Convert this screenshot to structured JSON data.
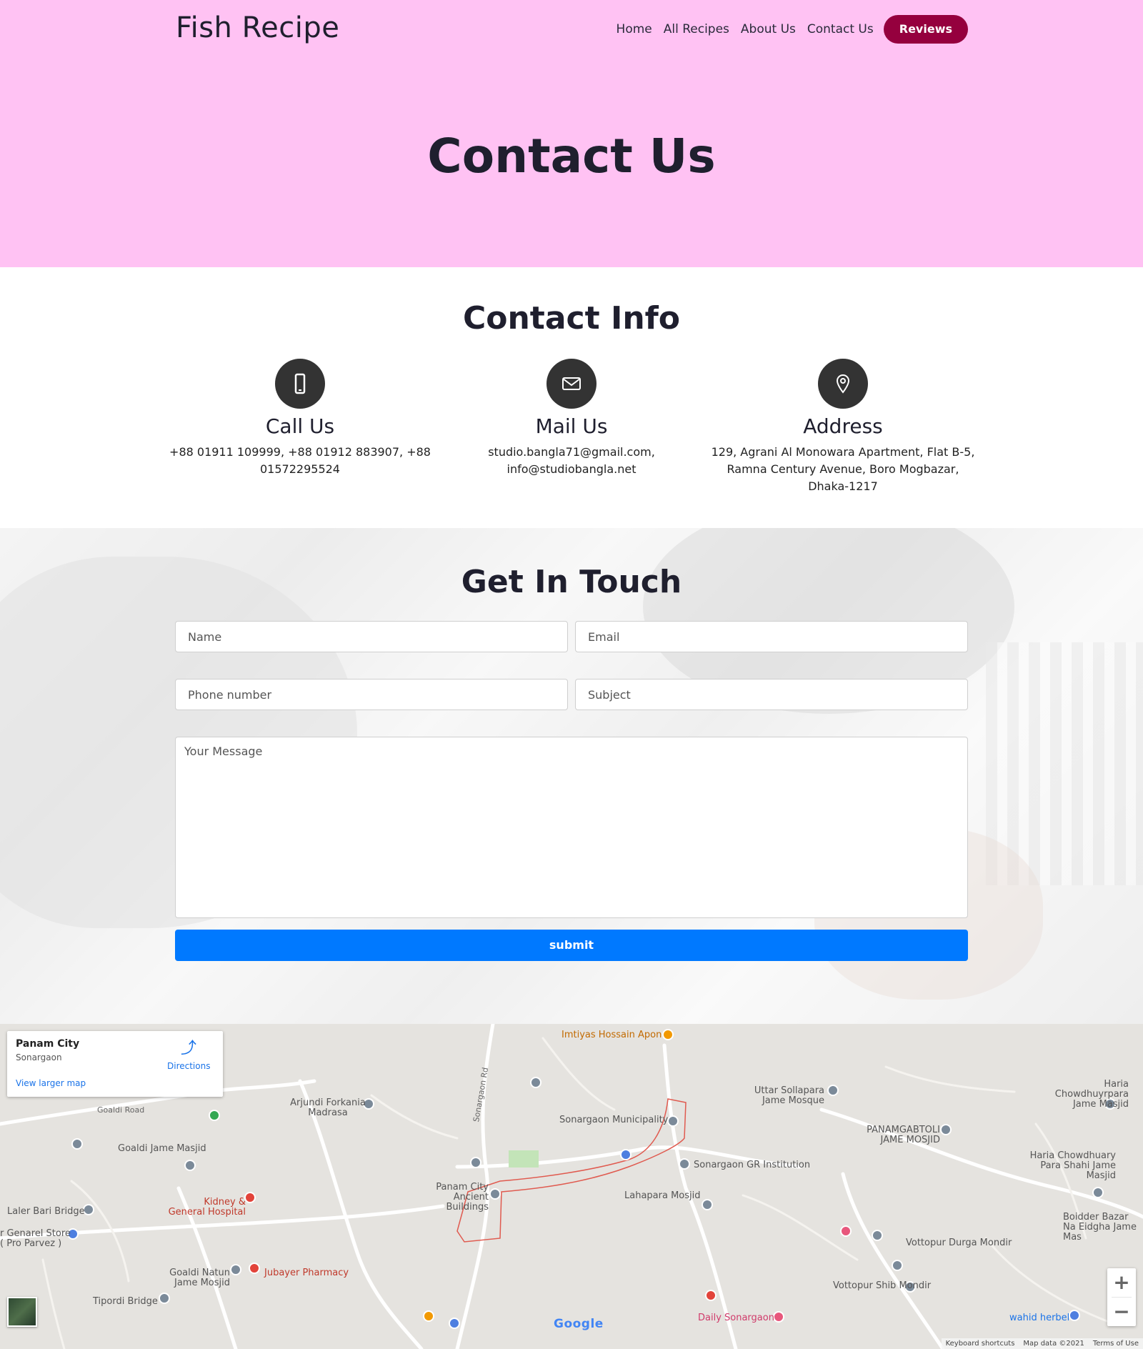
{
  "header": {
    "brand": "Fish Recipe",
    "nav": [
      "Home",
      "All Recipes",
      "About Us",
      "Contact Us"
    ],
    "cta": "Reviews",
    "hero_title": "Contact Us"
  },
  "colors": {
    "hero_bg": "#ffc2f3",
    "cta_bg": "#95003e",
    "icon_circle": "#333333",
    "submit_bg": "#0079ff"
  },
  "contact_info": {
    "title": "Contact Info",
    "items": [
      {
        "icon": "phone-icon",
        "heading": "Call Us",
        "text": "+88 01911 109999, +88 01912 883907, +88 01572295524"
      },
      {
        "icon": "mail-icon",
        "heading": "Mail Us",
        "text": "studio.bangla71@gmail.com, info@studiobangla.net"
      },
      {
        "icon": "location-pin-icon",
        "heading": "Address",
        "text": "129, Agrani Al Monowara Apartment, Flat B-5, Ramna Century Avenue, Boro Mogbazar, Dhaka-1217"
      }
    ]
  },
  "form": {
    "title": "Get In Touch",
    "name_placeholder": "Name",
    "email_placeholder": "Email",
    "phone_placeholder": "Phone number",
    "subject_placeholder": "Subject",
    "message_placeholder": "Your Message",
    "submit_label": "submit"
  },
  "map": {
    "card_place": "Panam City",
    "card_sub": "Sonargaon",
    "directions": "Directions",
    "larger_map": "View larger map",
    "labels": [
      "Imtiyas Hossain Apon",
      "Arjundi Forkania Madrasa",
      "Goaldi Jame Masjid",
      "Kidney & General Hospital",
      "Laler Bari Bridge",
      "r Genarel Store ( Pro Parvez )",
      "Goaldi Natun Jame Mosjid",
      "Jubayer Pharmacy",
      "Tipordi Bridge",
      "Sonargaon Municipality",
      "Panam City Ancient Buildings",
      "Sonargaon GR Institution",
      "Lahapara Mosjid",
      "Uttar Sollapara Jame Mosque",
      "PANAMGABTOLI JAME MOSJID",
      "Haria Chowdhuyrpara Jame Masjid",
      "Haria Chowdhuary Para Shahi Jame Masjid",
      "Boidder Bazar Na Eidgha Jame Mas",
      "Vottopur Durga Mondir",
      "Vottopur Shib Mondir",
      "wahid herbel",
      "Daily Sonargaon",
      "Goaldi Road",
      "Sonargaon Rd"
    ],
    "google": "Google",
    "shortcuts": "Keyboard shortcuts",
    "map_data": "Map data ©2021",
    "terms": "Terms of Use",
    "zoom_in": "+",
    "zoom_out": "−"
  }
}
